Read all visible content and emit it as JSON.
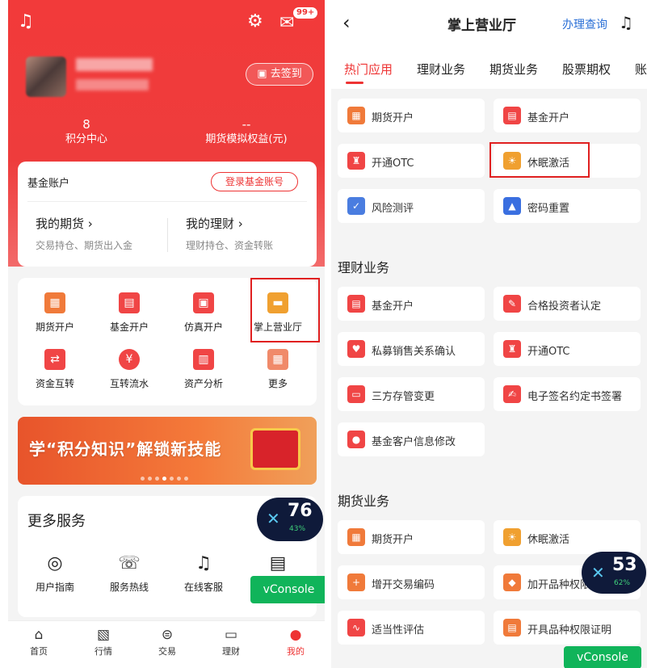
{
  "left": {
    "header": {
      "badge": "99+",
      "checkin_label": "去签到"
    },
    "stats": [
      {
        "value": "8",
        "label": "积分中心"
      },
      {
        "value": "--",
        "label": "期货模拟权益(元)"
      }
    ],
    "fund_account": {
      "title": "基金账户",
      "login_label": "登录基金账号"
    },
    "quick": [
      {
        "title": "我的期货 ›",
        "sub": "交易持仓、期货出入金"
      },
      {
        "title": "我的理财 ›",
        "sub": "理财持仓、资金转账"
      }
    ],
    "grid": [
      {
        "label": "期货开户",
        "icon": "calendar-icon",
        "glyph": "▦"
      },
      {
        "label": "基金开户",
        "icon": "id-card-icon",
        "glyph": "▤"
      },
      {
        "label": "仿真开户",
        "icon": "monitor-icon",
        "glyph": "▣"
      },
      {
        "label": "掌上营业厅",
        "icon": "briefcase-icon",
        "glyph": "▬"
      },
      {
        "label": "资金互转",
        "icon": "transfer-icon",
        "glyph": "⇄"
      },
      {
        "label": "互转流水",
        "icon": "yen-icon",
        "glyph": "¥"
      },
      {
        "label": "资产分析",
        "icon": "chart-icon",
        "glyph": "▥"
      },
      {
        "label": "更多",
        "icon": "grid-icon",
        "glyph": "▦"
      }
    ],
    "banner_text": "学“积分知识”解锁新技能",
    "more_services": {
      "title": "更多服务",
      "items": [
        {
          "label": "用户指南",
          "icon": "compass-icon",
          "glyph": "◎"
        },
        {
          "label": "服务热线",
          "icon": "phone-icon",
          "glyph": "☏"
        },
        {
          "label": "在线客服",
          "icon": "headset-icon",
          "glyph": "♫"
        },
        {
          "label": "",
          "icon": "list-icon",
          "glyph": "▤"
        }
      ]
    },
    "perf": {
      "value": "76",
      "pct": "43%"
    },
    "vconsole": "vConsole",
    "tabs": [
      {
        "label": "首页",
        "glyph": "⌂"
      },
      {
        "label": "行情",
        "glyph": "▧"
      },
      {
        "label": "交易",
        "glyph": "⊜"
      },
      {
        "label": "理财",
        "glyph": "▭"
      },
      {
        "label": "我的",
        "glyph": "●"
      }
    ],
    "accent": "#ee3c3c"
  },
  "right": {
    "title": "掌上营业厅",
    "query": "办理查询",
    "tabs": [
      "热门应用",
      "理财业务",
      "期货业务",
      "股票期权",
      "账"
    ],
    "hot": [
      {
        "label": "期货开户",
        "color": "#f07a3a",
        "glyph": "▦"
      },
      {
        "label": "基金开户",
        "color": "#f04545",
        "glyph": "▤"
      },
      {
        "label": "开通OTC",
        "color": "#f04545",
        "glyph": "♜"
      },
      {
        "label": "休眠激活",
        "color": "#f0a030",
        "glyph": "☀"
      },
      {
        "label": "风险测评",
        "color": "#4a7de0",
        "glyph": "✓"
      },
      {
        "label": "密码重置",
        "color": "#3a6fe0",
        "glyph": "▲"
      }
    ],
    "finance_title": "理财业务",
    "finance": [
      {
        "label": "基金开户",
        "color": "#f04545",
        "glyph": "▤"
      },
      {
        "label": "合格投资者认定",
        "color": "#f04545",
        "glyph": "✎"
      },
      {
        "label": "私募销售关系确认",
        "color": "#f04545",
        "glyph": "♥"
      },
      {
        "label": "开通OTC",
        "color": "#f04545",
        "glyph": "♜"
      },
      {
        "label": "三方存管变更",
        "color": "#f04545",
        "glyph": "▭"
      },
      {
        "label": "电子签名约定书签署",
        "color": "#f04545",
        "glyph": "✍"
      },
      {
        "label": "基金客户信息修改",
        "color": "#f04545",
        "glyph": "●"
      }
    ],
    "futures_title": "期货业务",
    "futures": [
      {
        "label": "期货开户",
        "color": "#f07a3a",
        "glyph": "▦"
      },
      {
        "label": "休眠激活",
        "color": "#f0a030",
        "glyph": "☀"
      },
      {
        "label": "增开交易编码",
        "color": "#f07a3a",
        "glyph": "+"
      },
      {
        "label": "加开品种权限",
        "color": "#f07a3a",
        "glyph": "◆"
      },
      {
        "label": "适当性评估",
        "color": "#f04545",
        "glyph": "∿"
      },
      {
        "label": "开具品种权限证明",
        "color": "#f07a3a",
        "glyph": "▤"
      }
    ],
    "perf": {
      "value": "53",
      "pct": "62%"
    },
    "vconsole": "vConsole"
  }
}
